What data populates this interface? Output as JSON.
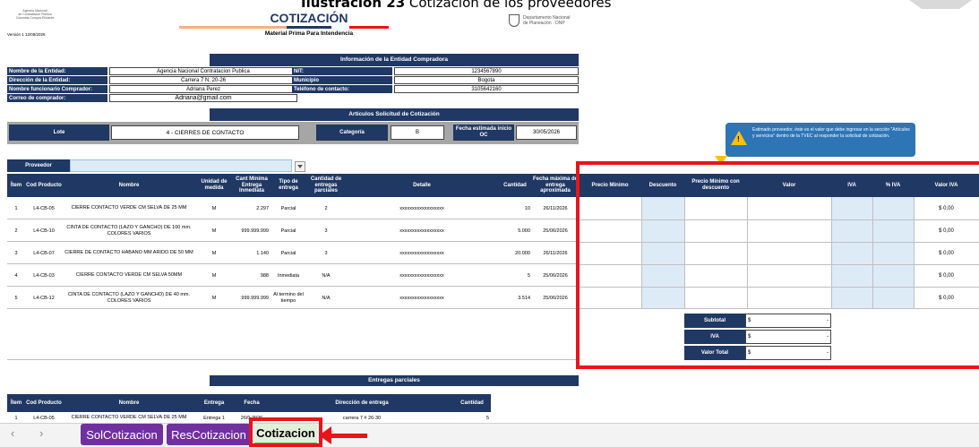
{
  "caption": {
    "bold": "Ilustración 23",
    "rest": " Cotización de los proveedores"
  },
  "header": {
    "logo_left_lines": [
      "Agencia Nacional",
      "de Contratación Pública",
      "Colombia Compra Eficiente"
    ],
    "title": "COTIZACIÓN",
    "subtitle": "Material Prima Para Intendencia",
    "version": "Versión 1   12/09/2026",
    "dnp_line1": "Departamento Nacional",
    "dnp_line2": "de Planeación · DNP"
  },
  "buyer": {
    "section_title": "Información de la Entidad Compradora",
    "entity_label": "Nombre de la Entidad:",
    "entity_value": "Agencia Nacional Contratacion Publica",
    "address_label": "Dirección de la Entidad:",
    "address_value": "Carrera 7 N. 20-26",
    "official_label": "Nombre funcionario Comprador:",
    "official_value": "Adriana Perez",
    "email_label": "Correo de comprador:",
    "email_value": "Adriana@gmail.com",
    "nit_label": "NIT:",
    "nit_value": "1234567890",
    "municipio_label": "Municipio",
    "municipio_value": "Bogota",
    "phone_label": "Teléfono de contacto:",
    "phone_value": "3105642160"
  },
  "articles": {
    "section_title": "Artículos Solicitud de Cotización",
    "lote_label": "Lote",
    "lote_value": "4 - CIERRES DE CONTACTO",
    "categoria_label": "Categoría",
    "categoria_value": "B",
    "fecha_label": "Fecha estimada inicio OC",
    "fecha_value": "30/05/2026",
    "proveedor_label": "Proveedor",
    "columns": [
      "Ítem",
      "Cod Producto",
      "Nombre",
      "Unidad de medida",
      "Cant Mínima Entrega Inmediata",
      "Tipo de entrega",
      "Cantidad de entregas parciales",
      "Detalle",
      "Cantidad",
      "Fecha máxima de entrega aproximada"
    ],
    "rows": [
      {
        "item": "1",
        "cod": "L4-CB-05",
        "nombre": "CIERRE CONTACTO VERDE CM SELVA DE 25 MM",
        "unidad": "M",
        "cant_min": "2.297",
        "tipo": "Parcial",
        "parciales": "2",
        "detalle": "xxxxxxxxxxxxxxxxxx",
        "cantidad": "10",
        "fecha": "26/11/2026"
      },
      {
        "item": "2",
        "cod": "L4-CB-10",
        "nombre": "CINTA DE CONTACTO (LAZO Y GANCHO) DE 100 mm. COLORES VARIOS",
        "unidad": "M",
        "cant_min": "999.999.999",
        "tipo": "Parcial",
        "parciales": "3",
        "detalle": "xxxxxxxxxxxxxxxxxx",
        "cantidad": "5.000",
        "fecha": "25/06/2026"
      },
      {
        "item": "3",
        "cod": "L4-CB-07",
        "nombre": "CIERRE DE CONTACTO HABANO MM ARIDO DE 50 MM",
        "unidad": "M",
        "cant_min": "1.140",
        "tipo": "Parcial",
        "parciales": "3",
        "detalle": "xxxxxxxxxxxxxxxxxx",
        "cantidad": "20.000",
        "fecha": "26/11/2026"
      },
      {
        "item": "4",
        "cod": "L4-CB-03",
        "nombre": "CIERRE CONTACTO VERDE CM SELVA 50MM",
        "unidad": "M",
        "cant_min": "988",
        "tipo": "Inmediata",
        "parciales": "N/A",
        "detalle": "xxxxxxxxxxxxxxxxxx",
        "cantidad": "5",
        "fecha": "25/06/2026"
      },
      {
        "item": "5",
        "cod": "L4-CB-12",
        "nombre": "CINTA DE CONTACTO (LAZO Y GANCHO) DE 40 mm. COLORES VARIOS",
        "unidad": "M",
        "cant_min": "999.999.999",
        "tipo": "Al termino del tiempo",
        "parciales": "N/A",
        "detalle": "xxxxxxxxxxxxxxxxxx",
        "cantidad": "3.514",
        "fecha": "25/06/2026"
      }
    ]
  },
  "pricing": {
    "tooltip": "Estimado proveedor, éste es el valor que debe ingresar en la sección \"Artículos y servicios\" dentro de la TVEC al responder la solicitud de cotización.",
    "columns": [
      "Precio Mínimo",
      "Descuento",
      "Precio Mínimo con descuento",
      "Valor",
      "IVA",
      "% IVA",
      "Valor IVA"
    ],
    "row_values": [
      "$ 0,00",
      "$ 0,00",
      "$ 0,00",
      "$ 0,00",
      "$ 0,00"
    ],
    "subtotal_label": "Subtotal",
    "iva_label": "IVA",
    "total_label": "Valor Total",
    "currency": "$",
    "dash": "-"
  },
  "deliveries": {
    "section_title": "Entregas parciales",
    "columns": [
      "Ítem",
      "Cod Producto",
      "Nombre",
      "Entrega",
      "Fecha",
      "Dirección de entrega",
      "Cantidad"
    ],
    "row": {
      "item": "1",
      "cod": "L4-CB-05",
      "nombre": "CIERRE CONTACTO VERDE CM SELVA DE 25 MM",
      "entrega": "Entrega 1",
      "fecha": "26/0 2026",
      "direccion": "carrera 7 # 26-30",
      "cantidad": "5"
    }
  },
  "sheet_tabs": [
    "SolCotizacion",
    "ResCotizacion",
    "Cotizacion"
  ],
  "add_sheet": "+",
  "colors": {
    "navy": "#1f3864",
    "red": "#e8141b",
    "purple": "#7030a0",
    "green": "#70ad47",
    "tooltip": "#2e75b6"
  }
}
